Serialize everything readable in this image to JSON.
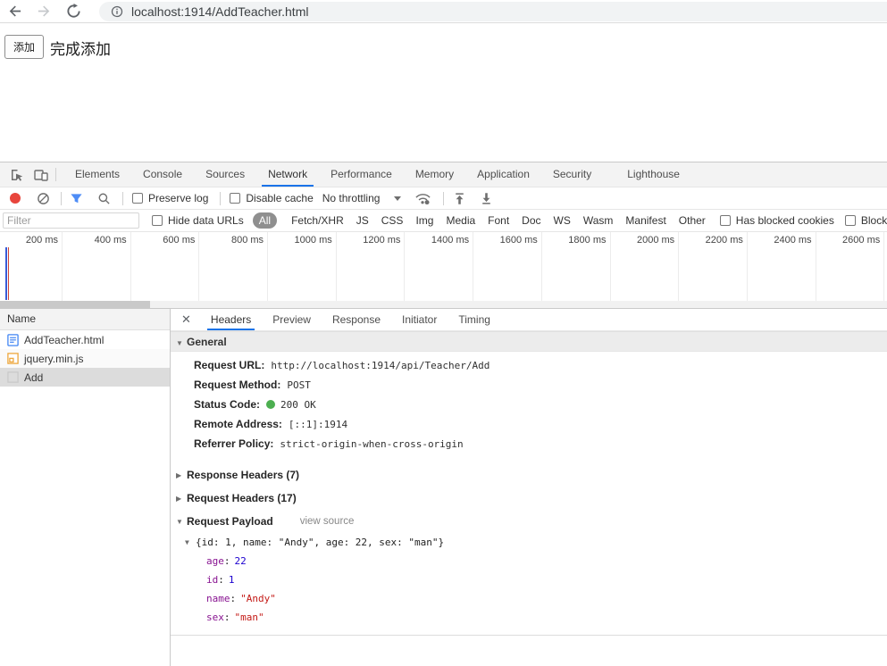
{
  "browser": {
    "url": "localhost:1914/AddTeacher.html"
  },
  "page": {
    "add_button_label": "添加",
    "status_text": "完成添加"
  },
  "devtools": {
    "tabs": [
      "Elements",
      "Console",
      "Sources",
      "Network",
      "Performance",
      "Memory",
      "Application",
      "Security",
      "Lighthouse"
    ],
    "active_tab": "Network",
    "toolbar": {
      "preserve_log_label": "Preserve log",
      "disable_cache_label": "Disable cache",
      "throttling_value": "No throttling"
    },
    "filter_bar": {
      "filter_placeholder": "Filter",
      "hide_data_urls_label": "Hide data URLs",
      "type_filters": [
        "All",
        "Fetch/XHR",
        "JS",
        "CSS",
        "Img",
        "Media",
        "Font",
        "Doc",
        "WS",
        "Wasm",
        "Manifest",
        "Other"
      ],
      "active_type_filter": "All",
      "has_blocked_cookies_label": "Has blocked cookies",
      "blocked_requests_label": "Blocked Requests"
    },
    "timeline": {
      "tick_labels": [
        "200 ms",
        "400 ms",
        "600 ms",
        "800 ms",
        "1000 ms",
        "1200 ms",
        "1400 ms",
        "1600 ms",
        "1800 ms",
        "2000 ms",
        "2200 ms",
        "2400 ms",
        "2600 ms"
      ],
      "dom_content_loaded_marker_color": "#3a5bd7",
      "load_marker_color": "#d04437"
    },
    "requests": {
      "name_header": "Name",
      "rows": [
        {
          "name": "AddTeacher.html",
          "icon": "html-document-icon",
          "selected": false
        },
        {
          "name": "jquery.min.js",
          "icon": "script-icon",
          "selected": false
        },
        {
          "name": "Add",
          "icon": "fetch-icon",
          "selected": true
        }
      ]
    },
    "details": {
      "tabs": [
        "Headers",
        "Preview",
        "Response",
        "Initiator",
        "Timing"
      ],
      "active_tab": "Headers",
      "general": {
        "title": "General",
        "fields": [
          {
            "label": "Request URL:",
            "value": "http://localhost:1914/api/Teacher/Add"
          },
          {
            "label": "Request Method:",
            "value": "POST"
          },
          {
            "label": "Status Code:",
            "value": "200 OK"
          },
          {
            "label": "Remote Address:",
            "value": "[::1]:1914"
          },
          {
            "label": "Referrer Policy:",
            "value": "strict-origin-when-cross-origin"
          }
        ],
        "status_dot_color": "#4caf50"
      },
      "sections": [
        {
          "title": "Response Headers (7)"
        },
        {
          "title": "Request Headers (17)"
        }
      ],
      "payload": {
        "title": "Request Payload",
        "view_source_label": "view source",
        "summary": "{id: 1, name: \"Andy\", age: 22, sex: \"man\"}",
        "properties": [
          {
            "key": "age",
            "value": "22",
            "type": "number"
          },
          {
            "key": "id",
            "value": "1",
            "type": "number"
          },
          {
            "key": "name",
            "value": "\"Andy\"",
            "type": "string"
          },
          {
            "key": "sex",
            "value": "\"man\"",
            "type": "string"
          }
        ]
      }
    }
  }
}
